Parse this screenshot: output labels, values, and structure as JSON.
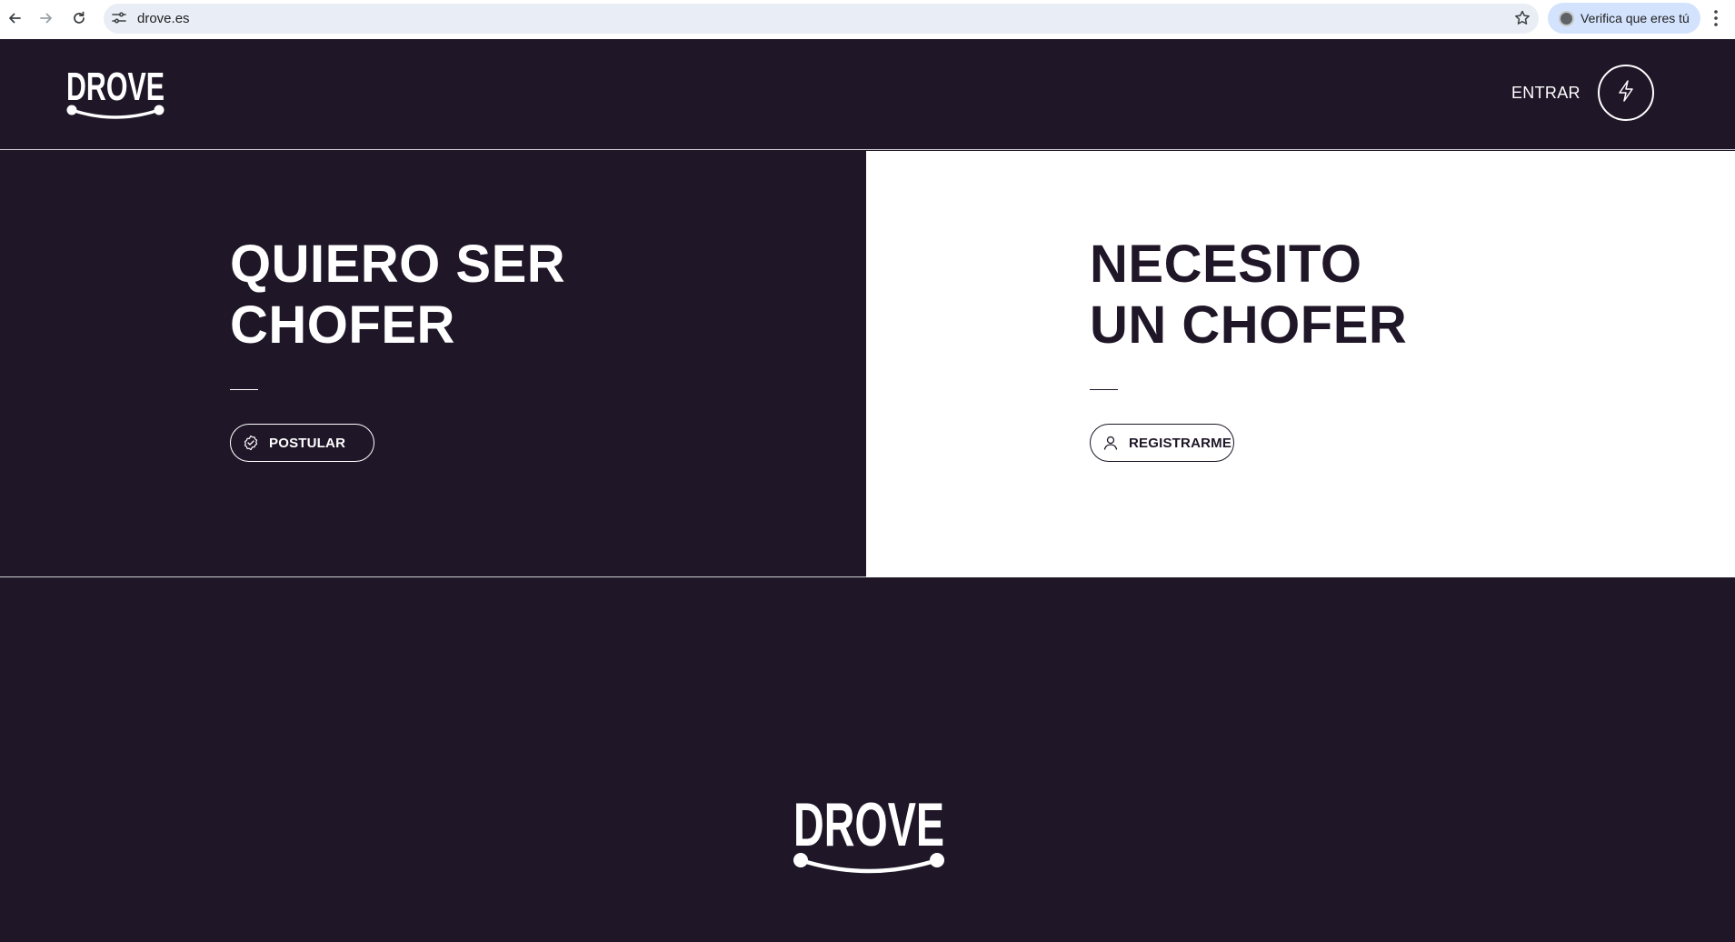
{
  "browser": {
    "url": "drove.es",
    "profile_label": "Verifica que eres tú",
    "icons": [
      "back-arrow-icon",
      "forward-arrow-icon",
      "reload-icon",
      "tune-icon",
      "star-icon",
      "kebab-menu-icon"
    ]
  },
  "header": {
    "logo_text": "DROVE",
    "login_label": "ENTRAR",
    "cta_icon": "bolt-icon"
  },
  "hero": {
    "driver": {
      "title_line1": "QUIERO SER",
      "title_line2": "CHOFER",
      "button_label": "POSTULAR",
      "button_icon": "check-badge-icon"
    },
    "client": {
      "title_line1": "NECESITO",
      "title_line2": "UN CHOFER",
      "button_label": "REGISTRARME",
      "button_icon": "user-icon"
    }
  },
  "footer": {
    "logo_text": "DROVE"
  },
  "colors": {
    "brand_dark": "#1f1627",
    "white": "#ffffff",
    "chrome_omnibox": "#e9eef6",
    "chrome_profile_chip": "#d3e3fd"
  }
}
